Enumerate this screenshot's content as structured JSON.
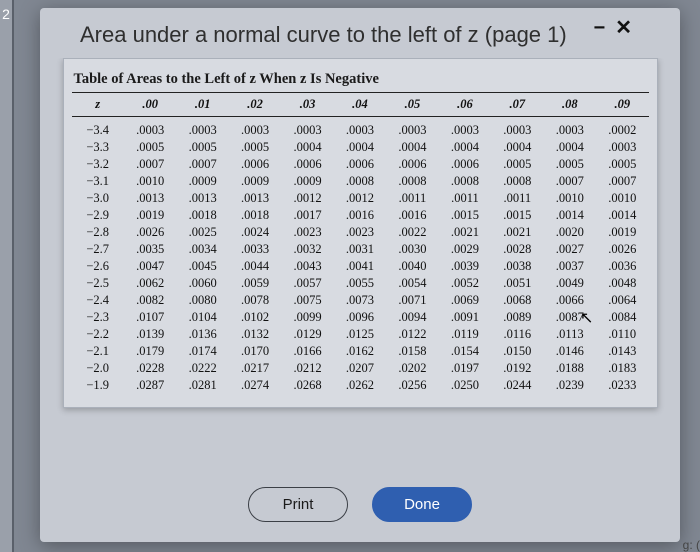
{
  "side_sliver": "2",
  "modal": {
    "title": "Area under a normal curve to the left of z (page 1)",
    "minimize_glyph": "−",
    "close_glyph": "✕"
  },
  "table": {
    "title": "Table of Areas to the Left of z When z Is Negative",
    "headers": [
      "z",
      ".00",
      ".01",
      ".02",
      ".03",
      ".04",
      ".05",
      ".06",
      ".07",
      ".08",
      ".09"
    ],
    "rows": [
      {
        "z": "−3.4",
        "v": [
          ".0003",
          ".0003",
          ".0003",
          ".0003",
          ".0003",
          ".0003",
          ".0003",
          ".0003",
          ".0003",
          ".0002"
        ]
      },
      {
        "z": "−3.3",
        "v": [
          ".0005",
          ".0005",
          ".0005",
          ".0004",
          ".0004",
          ".0004",
          ".0004",
          ".0004",
          ".0004",
          ".0003"
        ]
      },
      {
        "z": "−3.2",
        "v": [
          ".0007",
          ".0007",
          ".0006",
          ".0006",
          ".0006",
          ".0006",
          ".0006",
          ".0005",
          ".0005",
          ".0005"
        ]
      },
      {
        "z": "−3.1",
        "v": [
          ".0010",
          ".0009",
          ".0009",
          ".0009",
          ".0008",
          ".0008",
          ".0008",
          ".0008",
          ".0007",
          ".0007"
        ]
      },
      {
        "z": "−3.0",
        "v": [
          ".0013",
          ".0013",
          ".0013",
          ".0012",
          ".0012",
          ".0011",
          ".0011",
          ".0011",
          ".0010",
          ".0010"
        ]
      },
      {
        "z": "−2.9",
        "v": [
          ".0019",
          ".0018",
          ".0018",
          ".0017",
          ".0016",
          ".0016",
          ".0015",
          ".0015",
          ".0014",
          ".0014"
        ]
      },
      {
        "z": "−2.8",
        "v": [
          ".0026",
          ".0025",
          ".0024",
          ".0023",
          ".0023",
          ".0022",
          ".0021",
          ".0021",
          ".0020",
          ".0019"
        ]
      },
      {
        "z": "−2.7",
        "v": [
          ".0035",
          ".0034",
          ".0033",
          ".0032",
          ".0031",
          ".0030",
          ".0029",
          ".0028",
          ".0027",
          ".0026"
        ]
      },
      {
        "z": "−2.6",
        "v": [
          ".0047",
          ".0045",
          ".0044",
          ".0043",
          ".0041",
          ".0040",
          ".0039",
          ".0038",
          ".0037",
          ".0036"
        ]
      },
      {
        "z": "−2.5",
        "v": [
          ".0062",
          ".0060",
          ".0059",
          ".0057",
          ".0055",
          ".0054",
          ".0052",
          ".0051",
          ".0049",
          ".0048"
        ]
      },
      {
        "z": "−2.4",
        "v": [
          ".0082",
          ".0080",
          ".0078",
          ".0075",
          ".0073",
          ".0071",
          ".0069",
          ".0068",
          ".0066",
          ".0064"
        ]
      },
      {
        "z": "−2.3",
        "v": [
          ".0107",
          ".0104",
          ".0102",
          ".0099",
          ".0096",
          ".0094",
          ".0091",
          ".0089",
          ".0087",
          ".0084"
        ]
      },
      {
        "z": "−2.2",
        "v": [
          ".0139",
          ".0136",
          ".0132",
          ".0129",
          ".0125",
          ".0122",
          ".0119",
          ".0116",
          ".0113",
          ".0110"
        ]
      },
      {
        "z": "−2.1",
        "v": [
          ".0179",
          ".0174",
          ".0170",
          ".0166",
          ".0162",
          ".0158",
          ".0154",
          ".0150",
          ".0146",
          ".0143"
        ]
      },
      {
        "z": "−2.0",
        "v": [
          ".0228",
          ".0222",
          ".0217",
          ".0212",
          ".0207",
          ".0202",
          ".0197",
          ".0192",
          ".0188",
          ".0183"
        ]
      },
      {
        "z": "−1.9",
        "v": [
          ".0287",
          ".0281",
          ".0274",
          ".0268",
          ".0262",
          ".0256",
          ".0250",
          ".0244",
          ".0239",
          ".0233"
        ]
      }
    ]
  },
  "buttons": {
    "print": "Print",
    "done": "Done"
  },
  "cursor_glyph": "↖",
  "corner_hint": "g: ("
}
